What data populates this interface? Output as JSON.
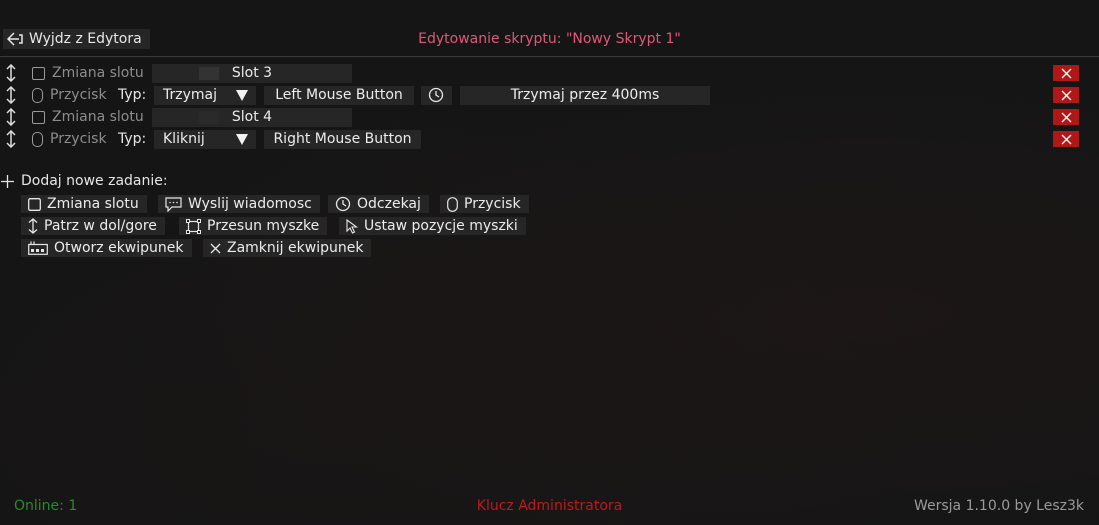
{
  "header": {
    "exit_label": "Wyjdz z Edytora",
    "title": "Edytowanie skryptu: \"Nowy Skrypt 1\"",
    "minimize_label": "_",
    "close_label": "✕"
  },
  "rows": [
    {
      "label": "Zmiana slotu",
      "value": "Slot 3"
    },
    {
      "label": "Przycisk",
      "type_label": "Typ:",
      "type_value": "Trzymaj",
      "button": "Left Mouse Button",
      "hold": "Trzymaj przez 400ms"
    },
    {
      "label": "Zmiana slotu",
      "value": "Slot 4"
    },
    {
      "label": "Przycisk",
      "type_label": "Typ:",
      "type_value": "Kliknij",
      "button": "Right Mouse Button"
    }
  ],
  "add_section": {
    "title": "Dodaj nowe zadanie:",
    "buttons": [
      "Zmiana slotu",
      "Wyslij wiadomosc",
      "Odczekaj",
      "Przycisk",
      "Patrz w dol/gore",
      "Przesun myszke",
      "Ustaw pozycje myszki",
      "Otworz ekwipunek",
      "Zamknij ekwipunek"
    ]
  },
  "footer": {
    "online": "Online: 1",
    "admin": "Klucz Administratora",
    "version": "Wersja 1.10.0 by Lesz3k"
  },
  "colors": {
    "background": "#151515",
    "title": "#e0577a",
    "delete": "#b01818",
    "online": "#2a8a2a",
    "admin": "#c0181c"
  }
}
